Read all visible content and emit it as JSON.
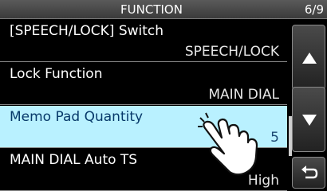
{
  "header": {
    "title": "FUNCTION",
    "page": "6/9"
  },
  "items": [
    {
      "label": "[SPEECH/LOCK] Switch",
      "value": "SPEECH/LOCK",
      "selected": false
    },
    {
      "label": "Lock Function",
      "value": "MAIN DIAL",
      "selected": false
    },
    {
      "label": "Memo Pad Quantity",
      "value": "5",
      "selected": true
    },
    {
      "label": "MAIN DIAL Auto TS",
      "value": "High",
      "selected": false
    }
  ],
  "controls": {
    "up_icon": "triangle-up-icon",
    "down_icon": "triangle-down-icon",
    "back_icon": "return-arrow-icon"
  },
  "colors": {
    "selected_bg": "#b9f1ff",
    "background": "#000000",
    "text": "#ffffff"
  }
}
